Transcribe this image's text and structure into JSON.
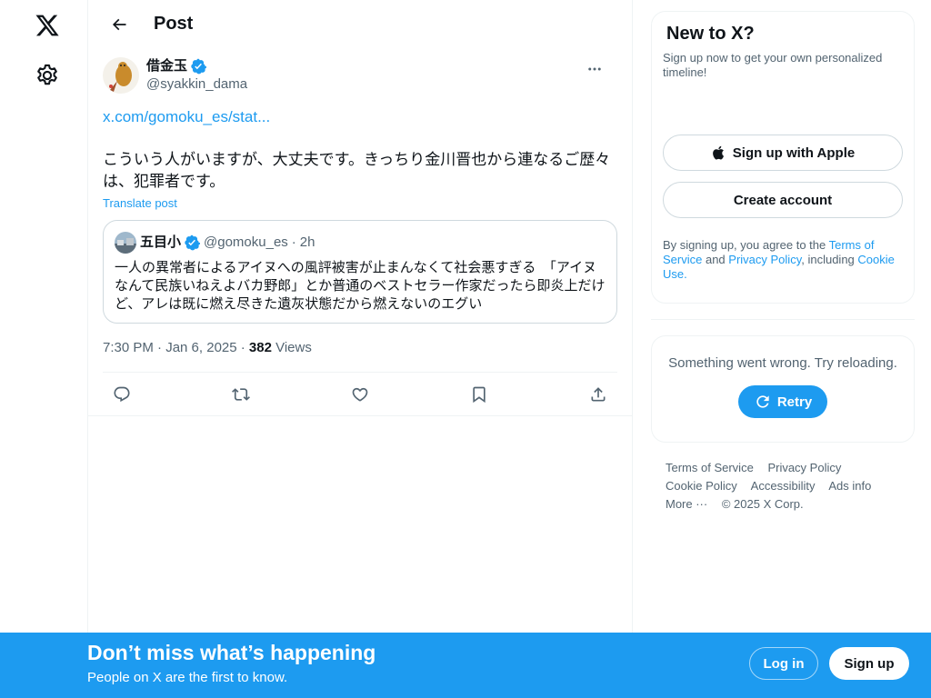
{
  "topbar": {
    "title": "Post"
  },
  "post": {
    "author_name": "借金玉",
    "author_handle": "@syakkin_dama",
    "link_text": "x.com/gomoku_es/stat...",
    "text": "こういう人がいますが、大丈夫です。きっちり金川晋也から連なるご歴々は、犯罪者です。",
    "translate_label": "Translate post",
    "timestamp": "7:30 PM · Jan 6, 2025 · ",
    "views_count": "382",
    "views_label": " Views"
  },
  "quote": {
    "name": "五目小",
    "handle": "@gomoku_es",
    "dot": "·",
    "time": "2h",
    "text": "一人の異常者によるアイヌへの風評被害が止まんなくて社会悪すぎる　「アイヌなんて民族いねえよバカ野郎」とか普通のベストセラー作家だったら即炎上だけど、アレは既に燃え尽きた遺灰状態だから燃えないのエグい"
  },
  "signup": {
    "title": "New to X?",
    "subtitle": "Sign up now to get your own personalized timeline!",
    "apple_label": "Sign up with Apple",
    "create_label": "Create account",
    "terms_prefix": "By signing up, you agree to the ",
    "terms_link": "Terms of Service",
    "terms_and": " and ",
    "privacy_link": "Privacy Policy",
    "terms_including": ", including ",
    "cookie_link": "Cookie Use.",
    "accent": "#1d9bf0"
  },
  "error_card": {
    "message": "Something went wrong. Try reloading.",
    "retry_label": "Retry"
  },
  "footer": {
    "terms": "Terms of Service",
    "privacy": "Privacy Policy",
    "cookie": "Cookie Policy",
    "accessibility": "Accessibility",
    "ads": "Ads info",
    "more": "More ···",
    "copyright": "© 2025 X Corp."
  },
  "banner": {
    "title": "Don’t miss what’s happening",
    "subtitle": "People on X are the first to know.",
    "login_label": "Log in",
    "signup_label": "Sign up",
    "background": "#1d9bf0"
  },
  "icons": {
    "logo": "x-logo-icon",
    "settings": "gear-icon",
    "back": "arrow-left-icon",
    "more": "more-icon",
    "verified": "verified-badge-icon",
    "reply": "reply-icon",
    "repost": "repost-icon",
    "like": "heart-icon",
    "bookmark": "bookmark-icon",
    "share": "share-icon",
    "apple": "apple-icon",
    "retry": "refresh-icon"
  }
}
